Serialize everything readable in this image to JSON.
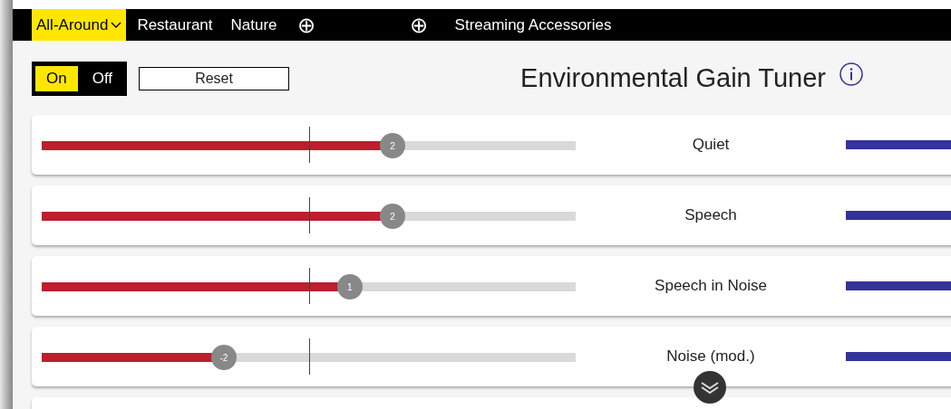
{
  "tabs": [
    {
      "label": "All-Around",
      "selected": true,
      "kind": "dropdown"
    },
    {
      "label": "Restaurant",
      "selected": false,
      "kind": "text"
    },
    {
      "label": "Nature",
      "selected": false,
      "kind": "text"
    },
    {
      "label": "⊕",
      "selected": false,
      "kind": "add"
    },
    {
      "label": "⊕",
      "selected": false,
      "kind": "add"
    },
    {
      "label": "Streaming Accessories",
      "selected": false,
      "kind": "text"
    }
  ],
  "power": {
    "options": [
      {
        "label": "On",
        "selected": true
      },
      {
        "label": "Off",
        "selected": false
      }
    ]
  },
  "reset_button": "Reset",
  "title": "Environmental Gain Tuner",
  "environments": [
    {
      "name": "Quiet",
      "value": "2",
      "level": 0.657
    },
    {
      "name": "Speech",
      "value": "2",
      "level": 0.657
    },
    {
      "name": "Speech in Noise",
      "value": "1",
      "level": 0.577
    },
    {
      "name": "Noise (mod.)",
      "value": "-2",
      "level": 0.341
    }
  ]
}
